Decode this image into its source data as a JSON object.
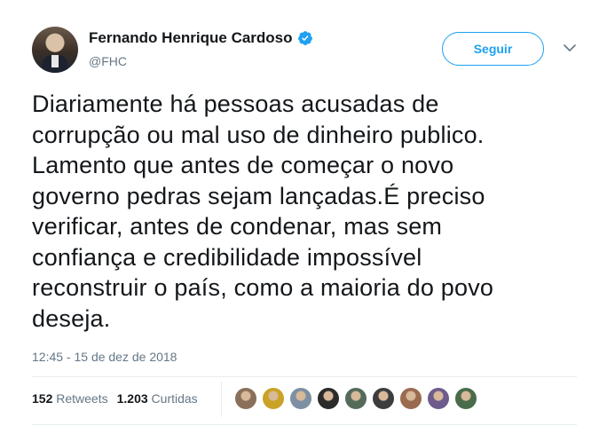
{
  "author": {
    "name": "Fernando Henrique Cardoso",
    "handle": "@FHC",
    "verified": true,
    "avatar_icon": "profile-photo"
  },
  "actions": {
    "follow_label": "Seguir",
    "menu_icon": "chevron-down-icon"
  },
  "tweet": {
    "text": "Diariamente há pessoas acusadas de\ncorrupção ou mal uso de dinheiro publico.\nLamento que antes de começar o novo\ngoverno pedras sejam lançadas.É preciso\nverificar, antes de condenar, mas sem\nconfiança e credibilidade impossível\nreconstruir o país, como a maioria do povo\ndeseja.",
    "timestamp": "12:45 - 15 de dez de 2018"
  },
  "stats": {
    "retweets_count": "152",
    "retweets_label": "Retweets",
    "likes_count": "1.203",
    "likes_label": "Curtidas"
  },
  "likers": [
    {
      "color": "#8a6f5a"
    },
    {
      "color": "#c9a227"
    },
    {
      "color": "#7d8fa3"
    },
    {
      "color": "#2b2b2b"
    },
    {
      "color": "#556b5a"
    },
    {
      "color": "#3d3d3d"
    },
    {
      "color": "#9a6b4f"
    },
    {
      "color": "#6d5b8c"
    },
    {
      "color": "#4a6b4a"
    }
  ],
  "colors": {
    "accent": "#1da1f2",
    "text": "#14171a",
    "secondary": "#657786"
  }
}
